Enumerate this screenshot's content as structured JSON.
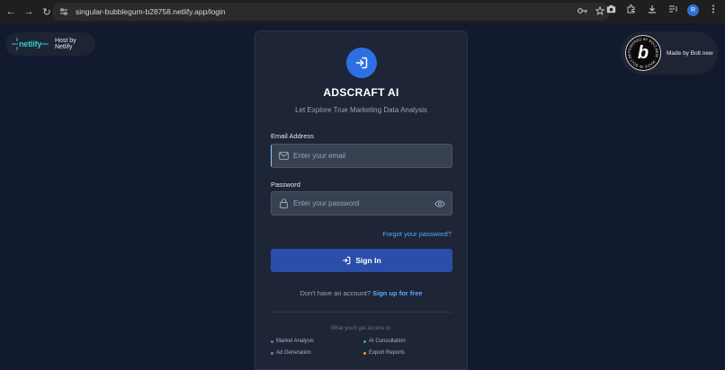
{
  "browser": {
    "url": "singular-bubblegum-b28758.netlify.app/login",
    "profile_initial": "R",
    "nav": {
      "back": "←",
      "forward": "→",
      "reload": "↻"
    }
  },
  "netlify_badge": {
    "logo": "netlify",
    "label": "Host by Netlify"
  },
  "bolt_badge": {
    "logo_letter": "b",
    "ring_text": "POWERED BY BOLT.NEW · MADE IN BOLT.NEW",
    "label": "Made by Bolt.new"
  },
  "login": {
    "title": "ADSCRAFT AI",
    "subtitle": "Let Explore True Marketing Data Analysis",
    "email": {
      "label": "Email Address",
      "placeholder": "Enter your email",
      "value": ""
    },
    "password": {
      "label": "Password",
      "placeholder": "Enter your password",
      "value": ""
    },
    "forgot_label": "Forgot your password?",
    "signin_label": "Sign In",
    "signup_prompt": "Don't have an account?",
    "signup_link": "Sign up for free",
    "access_title": "What you'll get access to:",
    "features": [
      {
        "label": "Market Analysis",
        "color": "#3b82f6"
      },
      {
        "label": "AI Consultation",
        "color": "#22c55e"
      },
      {
        "label": "Ad Generation",
        "color": "#a855f7"
      },
      {
        "label": "Export Reports",
        "color": "#f59e0b"
      }
    ]
  },
  "colors": {
    "accent": "#2f6fe4",
    "link": "#60a5fa",
    "button": "#2b4fa8",
    "background": "#111a2e",
    "card": "#1d2536"
  }
}
